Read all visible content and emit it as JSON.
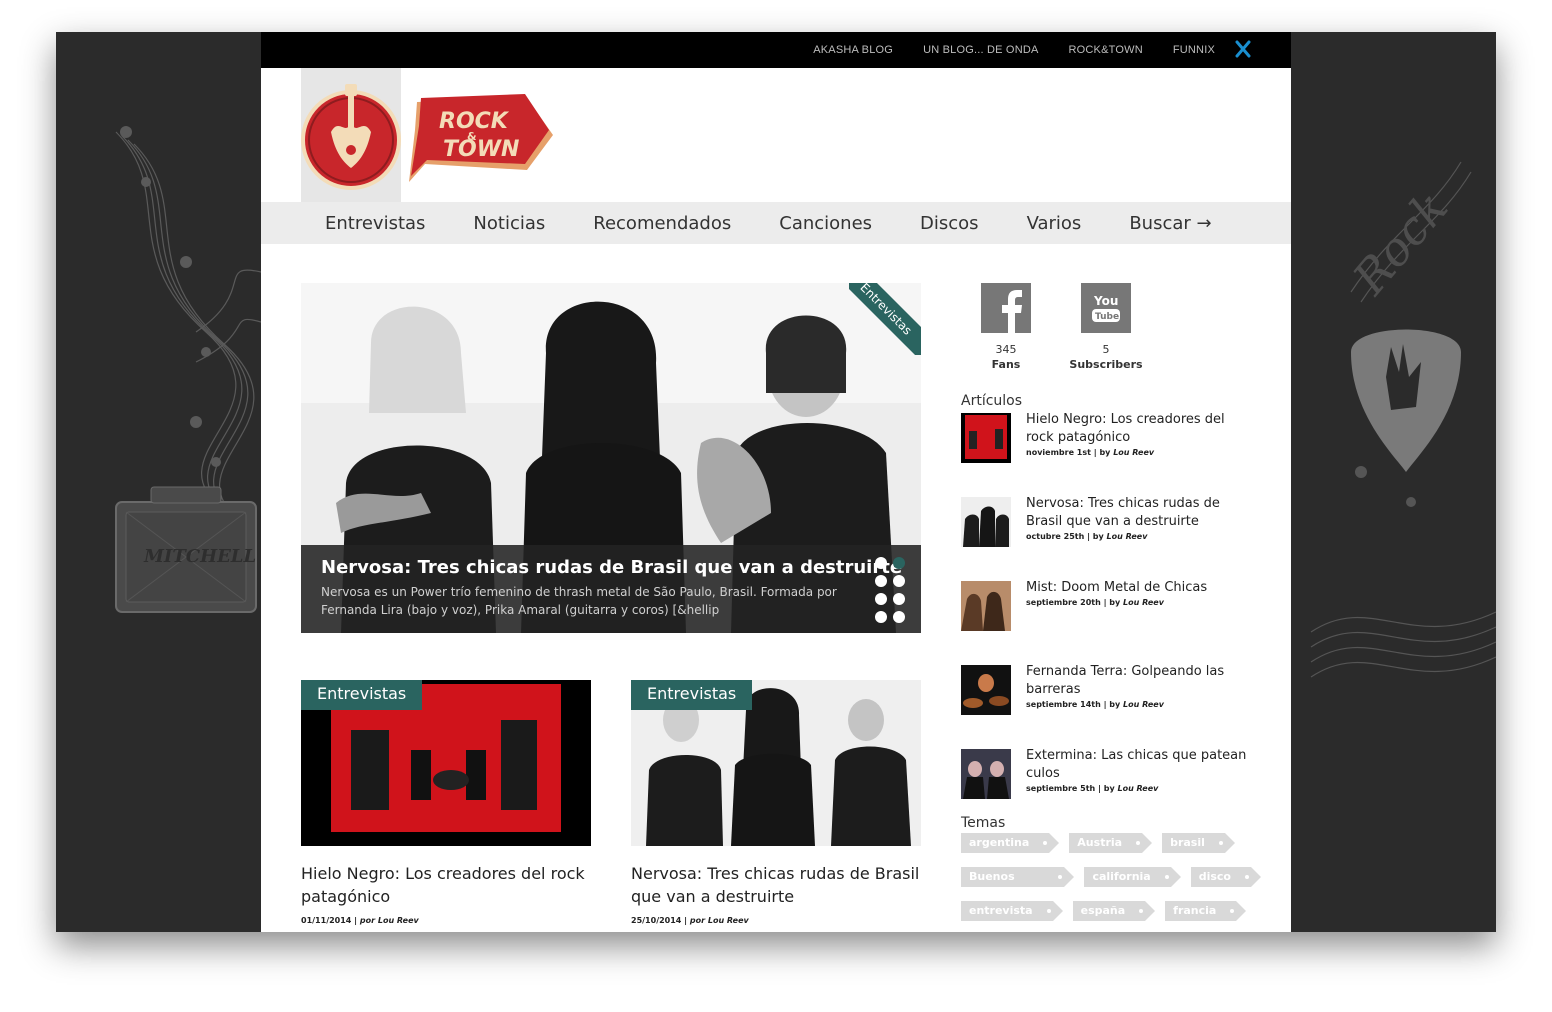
{
  "topbar": {
    "links": [
      "AKASHA BLOG",
      "UN BLOG... DE ONDA",
      "ROCK&TOWN",
      "FUNNIX"
    ]
  },
  "brand": {
    "sign_line1": "ROCK",
    "sign_amp": "&",
    "sign_line2": "TOWN",
    "amp_label": "MITCHELL"
  },
  "nav": {
    "items": [
      "Entrevistas",
      "Noticias",
      "Recomendados",
      "Canciones",
      "Discos",
      "Varios",
      "Buscar →"
    ]
  },
  "hero": {
    "category": "Entrevistas",
    "title": "Nervosa: Tres chicas rudas de Brasil que van a destruirte",
    "excerpt": "Nervosa es un Power trío femenino de thrash metal de São Paulo, Brasil. Formada por Fernanda Lira (bajo y voz), Prika Amaral (guitarra y coros) [&hellip"
  },
  "cards": [
    {
      "category": "Entrevistas",
      "title": "Hielo Negro: Los creadores del rock patagónico",
      "date": "01/11/2014",
      "by": "por",
      "author": "Lou Reev"
    },
    {
      "category": "Entrevistas",
      "title": "Nervosa: Tres chicas rudas de Brasil que van a destruirte",
      "date": "25/10/2014",
      "by": "por",
      "author": "Lou Reev"
    }
  ],
  "social": {
    "facebook": {
      "count": "345",
      "label": "Fans",
      "icon": "facebook-icon"
    },
    "youtube": {
      "count": "5",
      "label": "Subscribers",
      "icon": "youtube-icon",
      "badge_top": "You",
      "badge_bottom": "Tube"
    }
  },
  "articles": {
    "heading": "Artículos",
    "items": [
      {
        "title": "Hielo Negro: Los creadores del rock patagónico",
        "date": "noviembre 1st",
        "by": "by",
        "author": "Lou Reev"
      },
      {
        "title": "Nervosa: Tres chicas rudas de Brasil que van a destruirte",
        "date": "octubre 25th",
        "by": "by",
        "author": "Lou Reev"
      },
      {
        "title": "Mist: Doom Metal de Chicas",
        "date": "septiembre 20th",
        "by": "by",
        "author": "Lou Reev"
      },
      {
        "title": "Fernanda Terra: Golpeando las barreras",
        "date": "septiembre 14th",
        "by": "by",
        "author": "Lou Reev"
      },
      {
        "title": "Extermina: Las chicas que patean culos",
        "date": "septiembre 5th",
        "by": "by",
        "author": "Lou Reev"
      }
    ]
  },
  "topics": {
    "heading": "Temas",
    "rows": [
      [
        "argentina",
        "Austria",
        "brasil"
      ],
      [
        "Buenos Aires",
        "california",
        "disco"
      ],
      [
        "entrevista",
        "españa",
        "francia"
      ]
    ]
  },
  "colors": {
    "accent": "#2a6460",
    "brand_red": "#c8262b",
    "frame": "#2b2b2b"
  }
}
